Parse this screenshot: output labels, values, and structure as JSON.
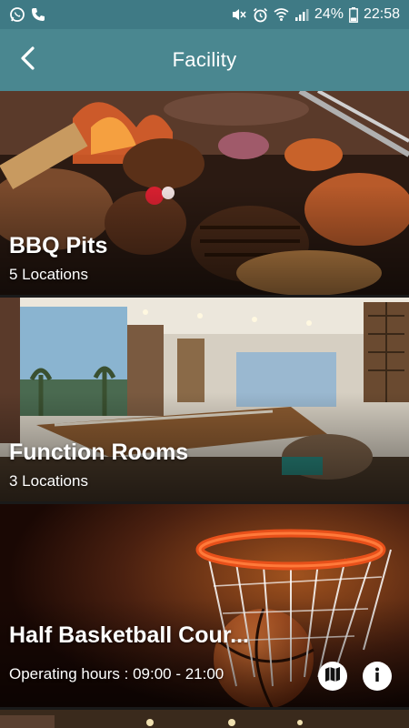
{
  "status_bar": {
    "battery": "24%",
    "time": "22:58",
    "left_icons": [
      "whatsapp-icon",
      "phone-icon"
    ],
    "right_icons": [
      "mute-icon",
      "alarm-icon",
      "wifi-icon",
      "signal-icon",
      "battery-icon"
    ]
  },
  "app_bar": {
    "title": "Facility",
    "back_icon": "chevron-left-icon"
  },
  "facilities": [
    {
      "title": "BBQ Pits",
      "subtitle": "5 Locations"
    },
    {
      "title": "Function Rooms",
      "subtitle": "3 Locations"
    },
    {
      "title": "Half Basketball Cour...",
      "subtitle": "Operating hours : 09:00 - 21:00",
      "actions": [
        "map-icon",
        "info-icon"
      ]
    }
  ],
  "colors": {
    "status_bar": "#3f7a85",
    "app_bar": "#4a8790",
    "text": "#ffffff"
  }
}
